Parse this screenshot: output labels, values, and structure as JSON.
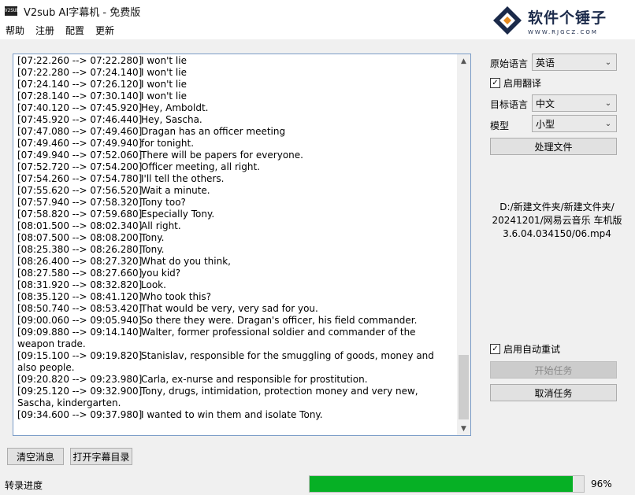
{
  "window": {
    "app_icon_text": "V2SUB",
    "title": "V2sub AI字幕机 - 免费版"
  },
  "watermark": {
    "name": "软件个锤子",
    "url": "WWW.RJGCZ.COM",
    "color": "#1b2a4a"
  },
  "menu": [
    "帮助",
    "注册",
    "配置",
    "更新"
  ],
  "log": [
    {
      "ts": "[07:22.260 --> 07:22.280]",
      "text": "I won't lie"
    },
    {
      "ts": "[07:22.280 --> 07:24.140]",
      "text": "I won't lie"
    },
    {
      "ts": "[07:24.140 --> 07:26.120]",
      "text": "I won't lie"
    },
    {
      "ts": "[07:28.140 --> 07:30.140]",
      "text": "I won't lie"
    },
    {
      "ts": "[07:40.120 --> 07:45.920]",
      "text": "Hey, Amboldt."
    },
    {
      "ts": "[07:45.920 --> 07:46.440]",
      "text": "Hey, Sascha."
    },
    {
      "ts": "[07:47.080 --> 07:49.460]",
      "text": "Dragan has an officer meeting"
    },
    {
      "ts": "[07:49.460 --> 07:49.940]",
      "text": "for tonight."
    },
    {
      "ts": "[07:49.940 --> 07:52.060]",
      "text": "There will be papers for everyone."
    },
    {
      "ts": "[07:52.720 --> 07:54.200]",
      "text": "Officer meeting, all right."
    },
    {
      "ts": "[07:54.260 --> 07:54.780]",
      "text": "I'll tell the others."
    },
    {
      "ts": "[07:55.620 --> 07:56.520]",
      "text": "Wait a minute."
    },
    {
      "ts": "[07:57.940 --> 07:58.320]",
      "text": "Tony too?"
    },
    {
      "ts": "[07:58.820 --> 07:59.680]",
      "text": "Especially Tony."
    },
    {
      "ts": "[08:01.500 --> 08:02.340]",
      "text": "All right."
    },
    {
      "ts": "[08:07.500 --> 08:08.200]",
      "text": "Tony."
    },
    {
      "ts": "[08:25.380 --> 08:26.280]",
      "text": "Tony."
    },
    {
      "ts": "[08:26.400 --> 08:27.320]",
      "text": "What do you think,"
    },
    {
      "ts": "[08:27.580 --> 08:27.660]",
      "text": "you kid?"
    },
    {
      "ts": "[08:31.920 --> 08:32.820]",
      "text": "Look."
    },
    {
      "ts": "[08:35.120 --> 08:41.120]",
      "text": "Who took this?"
    },
    {
      "ts": "[08:50.740 --> 08:53.420]",
      "text": "That would be very, very sad for you."
    },
    {
      "ts": "[09:00.060 --> 09:05.940]",
      "text": "So there they were. Dragan's officer, his field commander."
    },
    {
      "ts": "[09:09.880 --> 09:14.140]",
      "text": "Walter, former professional soldier and commander of the weapon trade."
    },
    {
      "ts": "[09:15.100 --> 09:19.820]",
      "text": "Stanislav, responsible for the smuggling of goods, money and also people."
    },
    {
      "ts": "[09:20.820 --> 09:23.980]",
      "text": "Carla, ex-nurse and responsible for prostitution."
    },
    {
      "ts": "[09:25.120 --> 09:32.900]",
      "text": "Tony, drugs, intimidation, protection money and very new, Sascha, kindergarten."
    },
    {
      "ts": "[09:34.600 --> 09:37.980]",
      "text": "I wanted to win them and isolate Tony."
    }
  ],
  "settings": {
    "source_lang_label": "原始语言",
    "source_lang_value": "英语",
    "enable_translate_label": "启用翻译",
    "enable_translate_checked": true,
    "target_lang_label": "目标语言",
    "target_lang_value": "中文",
    "model_label": "模型",
    "model_value": "小型",
    "process_file_button": "处理文件",
    "file_path": "D:/新建文件夹/新建文件夹/\n20241201/网易云音乐 车机版\n3.6.04.034150/06.mp4",
    "auto_retry_label": "启用自动重试",
    "auto_retry_checked": true,
    "start_task_button": "开始任务",
    "cancel_task_button": "取消任务"
  },
  "bottom": {
    "clear_button": "清空消息",
    "open_dir_button": "打开字幕目录",
    "status_label": "转录进度",
    "progress_value": 96,
    "progress_text": "96%",
    "progress_color": "#06b025"
  },
  "icons": {
    "checkmark": "✓",
    "chevron_down": "⌄",
    "scroll_up": "▲",
    "scroll_down": "▼"
  }
}
